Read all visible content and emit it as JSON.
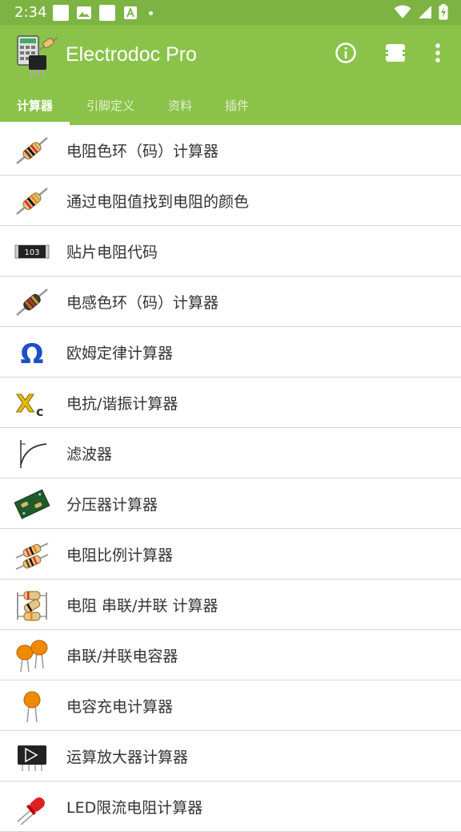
{
  "status_bar": {
    "time": "2:34"
  },
  "app": {
    "title": "Electrodoc Pro",
    "actions": [
      "info-icon",
      "plug-icon",
      "more-vert-icon"
    ]
  },
  "tabs": [
    {
      "label": "计算器",
      "active": true
    },
    {
      "label": "引脚定义",
      "active": false
    },
    {
      "label": "资料",
      "active": false
    },
    {
      "label": "插件",
      "active": false
    }
  ],
  "items": [
    {
      "label": "电阻色环（码）计算器",
      "icon": "resistor-icon"
    },
    {
      "label": "通过电阻值找到电阻的颜色",
      "icon": "resistor-icon"
    },
    {
      "label": "贴片电阻代码",
      "icon": "smd-resistor-icon"
    },
    {
      "label": "电感色环（码）计算器",
      "icon": "inductor-icon"
    },
    {
      "label": "欧姆定律计算器",
      "icon": "omega-icon"
    },
    {
      "label": "电抗/谐振计算器",
      "icon": "reactance-icon"
    },
    {
      "label": "滤波器",
      "icon": "filter-curve-icon"
    },
    {
      "label": "分压器计算器",
      "icon": "pcb-icon"
    },
    {
      "label": "电阻比例计算器",
      "icon": "resistor-pair-icon"
    },
    {
      "label": "电阻 串联/并联 计算器",
      "icon": "resistor-network-icon"
    },
    {
      "label": "串联/并联电容器",
      "icon": "capacitor-pair-icon"
    },
    {
      "label": "电容充电计算器",
      "icon": "capacitor-icon"
    },
    {
      "label": "运算放大器计算器",
      "icon": "opamp-chip-icon"
    },
    {
      "label": "LED限流电阻计算器",
      "icon": "led-icon"
    }
  ]
}
